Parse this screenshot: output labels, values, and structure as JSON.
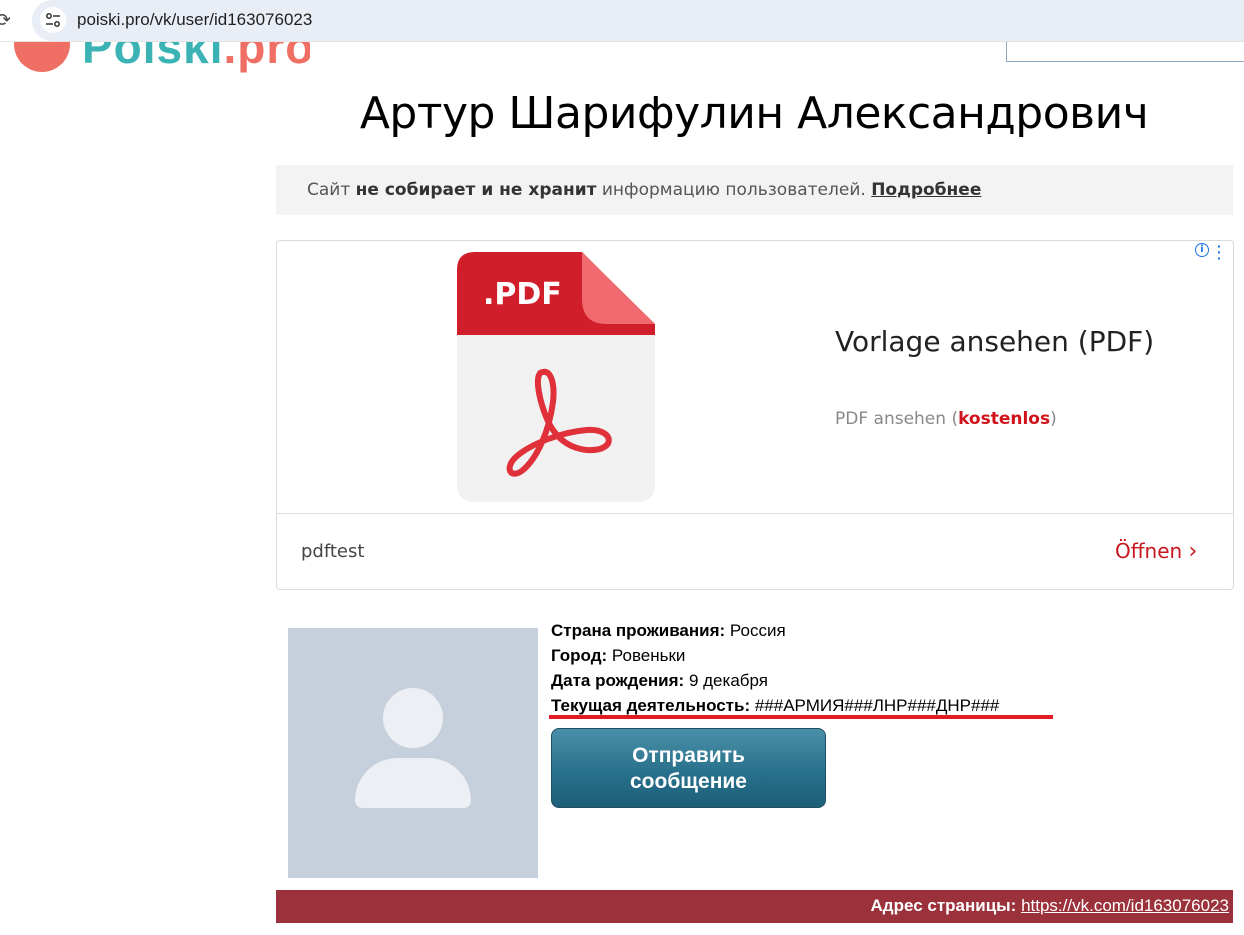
{
  "browser": {
    "url": "poiski.pro/vk/user/id163076023"
  },
  "site": {
    "logo_text_main": "Poiski",
    "logo_text_suffix": ".pro"
  },
  "profile": {
    "name": "Артур Шарифулин Александрович",
    "fields": [
      {
        "label": "Страна проживания:",
        "value": "Россия"
      },
      {
        "label": "Город:",
        "value": "Ровеньки"
      },
      {
        "label": "Дата рождения:",
        "value": "9 декабря"
      },
      {
        "label": "Текущая деятельность:",
        "value": "###АРМИЯ###ЛНР###ДНР###"
      }
    ],
    "send_message_label": "Отправить сообщение"
  },
  "notice": {
    "prefix": "Сайт ",
    "bold": "не собирает и не хранит",
    "suffix": " информацию пользователей. ",
    "link": "Подробнее"
  },
  "ad": {
    "pdf_badge": ".PDF",
    "headline": "Vorlage ansehen (PDF)",
    "desc_prefix": "PDF ansehen (",
    "desc_highlight": "kostenlos",
    "desc_suffix": ")",
    "advertiser": "pdftest",
    "cta": "Öffnen",
    "info_glyph": "i",
    "colors": {
      "pdf_red": "#d01f2a",
      "pdf_body": "#f1f1f1",
      "cta": "#c8161d"
    }
  },
  "footer": {
    "label": "Адрес страницы:",
    "link": "https://vk.com/id163076023",
    "color": "#9b323b"
  },
  "icons": [
    "reload-icon",
    "site-info-icon",
    "ad-info-icon",
    "ad-menu-icon",
    "chevron-right-icon",
    "pdf-file-icon",
    "acrobat-icon",
    "avatar-placeholder-icon"
  ]
}
